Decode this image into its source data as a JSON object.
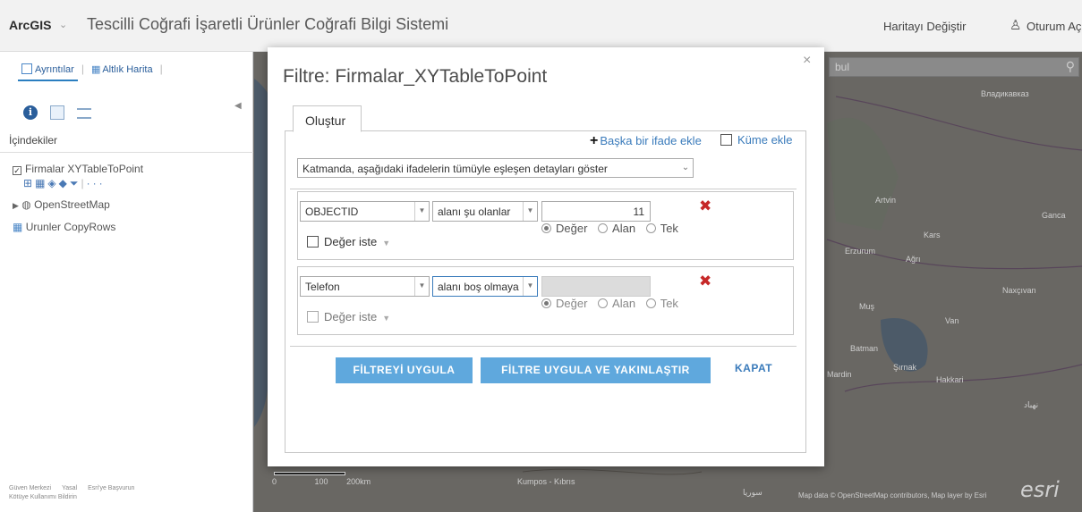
{
  "header": {
    "brand": "ArcGIS",
    "title": "Tescilli Coğrafi İşaretli Ürünler Coğrafi Bilgi Sistemi",
    "change_map": "Haritayı Değiştir",
    "sign_in": "Oturum Aç"
  },
  "left_panel": {
    "tabs": [
      "Ayrıntılar",
      "Altlık Harita"
    ],
    "contents_label": "İçindekiler",
    "layers": [
      "Firmalar XYTableToPoint",
      "OpenStreetMap",
      "Urunler CopyRows"
    ],
    "layer_tools_more": "···",
    "footer": [
      "Güven Merkezi",
      "Yasal",
      "Esri'ye Başvurun",
      "Kötüye Kullanımı Bildirin"
    ]
  },
  "map": {
    "search_placeholder": "bul",
    "labels": [
      "Владикавказ",
      "Artvin",
      "Ganca",
      "Kars",
      "Erzurum",
      "Ağrı",
      "Naxçıvan",
      "Muş",
      "Van",
      "Batman",
      "Şırnak",
      "Mardin",
      "Hakkari",
      "Kumpos - Kıbrıs",
      "سوريا",
      "نهباد"
    ],
    "scale_labels": [
      "0",
      "100",
      "200km"
    ],
    "attribution": "Map data © OpenStreetMap contributors, Map layer by Esri",
    "logo": "esri"
  },
  "dialog": {
    "title": "Filtre: Firmalar_XYTableToPoint",
    "close": "×",
    "tab": "Oluştur",
    "add_expression": "Başka bir ifade ekle",
    "add_set": "Küme ekle",
    "match_mode": "Katmanda, aşağıdaki ifadelerin tümüyle eşleşen detayları göster",
    "expressions": [
      {
        "field": "OBJECTID",
        "operator": "alanı şu olanlar",
        "value": "11",
        "radio_options": [
          "Değer",
          "Alan",
          "Tek"
        ],
        "selected": "Değer",
        "ask_values": "Değer iste"
      },
      {
        "field": "Telefon",
        "operator": "alanı boş olmaya",
        "value": "",
        "radio_options": [
          "Değer",
          "Alan",
          "Tek"
        ],
        "selected": "Değer",
        "ask_values": "Değer iste"
      }
    ],
    "buttons": {
      "apply": "FİLTREYİ UYGULA",
      "apply_zoom": "FİLTRE UYGULA VE YAKINLAŞTIR",
      "close": "KAPAT"
    }
  }
}
